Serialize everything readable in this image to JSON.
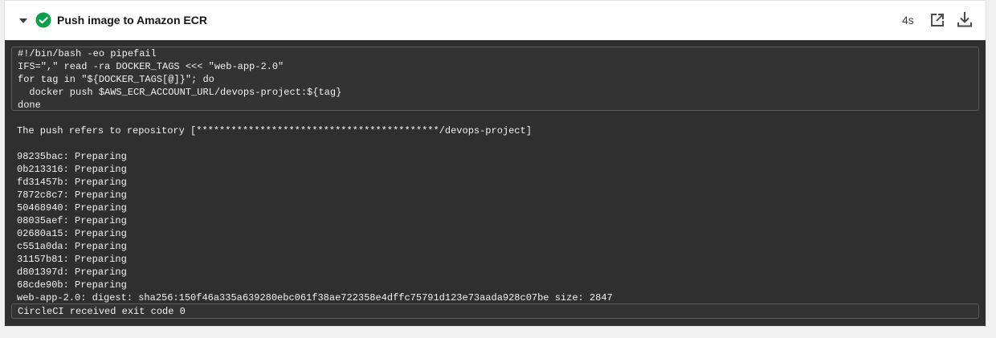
{
  "step": {
    "title": "Push image to Amazon ECR",
    "duration": "4s",
    "status_color": "#0b9f4a",
    "icons": {
      "collapse": "chevron-down-icon",
      "status": "check-circle-icon",
      "open": "open-in-new-icon",
      "download": "download-icon"
    }
  },
  "terminal": {
    "command_lines": [
      "#!/bin/bash -eo pipefail",
      "IFS=\",\" read -ra DOCKER_TAGS <<< \"web-app-2.0\"",
      "for tag in \"${DOCKER_TAGS[@]}\"; do",
      "  docker push $AWS_ECR_ACCOUNT_URL/devops-project:${tag}",
      "done"
    ],
    "push_message": "The push refers to repository [******************************************/devops-project]",
    "layers": [
      "98235bac: Preparing",
      "0b213316: Preparing",
      "fd31457b: Preparing",
      "7872c8c7: Preparing",
      "50468940: Preparing",
      "08035aef: Preparing",
      "02680a15: Preparing",
      "c551a0da: Preparing",
      "31157b81: Preparing",
      "d801397d: Preparing",
      "68cde90b: Preparing"
    ],
    "digest_line": "web-app-2.0: digest: sha256:150f46a335a639280ebc061f38ae722358e4dffc75791d123e73aada928c07be size: 2847",
    "exit_line": "CircleCI received exit code 0"
  }
}
